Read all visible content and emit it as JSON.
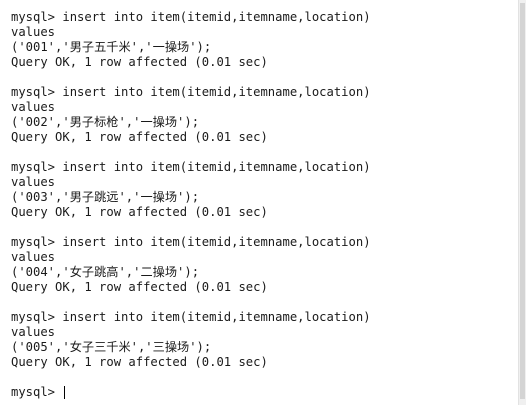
{
  "terminal": {
    "blocks": [
      {
        "command": "mysql> insert into item(itemid,itemname,location)",
        "values_kw": "values",
        "values": "('001','男子五千米','一操场');",
        "result": "Query OK, 1 row affected (0.01 sec)"
      },
      {
        "command": "mysql> insert into item(itemid,itemname,location)",
        "values_kw": "values",
        "values": "('002','男子标枪','一操场');",
        "result": "Query OK, 1 row affected (0.01 sec)"
      },
      {
        "command": "mysql> insert into item(itemid,itemname,location)",
        "values_kw": "values",
        "values": "('003','男子跳远','一操场');",
        "result": "Query OK, 1 row affected (0.01 sec)"
      },
      {
        "command": "mysql> insert into item(itemid,itemname,location)",
        "values_kw": "values",
        "values": "('004','女子跳高','二操场');",
        "result": "Query OK, 1 row affected (0.01 sec)"
      },
      {
        "command": "mysql> insert into item(itemid,itemname,location)",
        "values_kw": "values",
        "values": "('005','女子三千米','三操场');",
        "result": "Query OK, 1 row affected (0.01 sec)"
      }
    ],
    "prompt": "mysql> ",
    "colors": {
      "background": "#ffffff",
      "text": "#1a1a1a",
      "scrollbar_track": "#f0f0f0",
      "scrollbar_thumb": "#d4d4d4"
    }
  }
}
